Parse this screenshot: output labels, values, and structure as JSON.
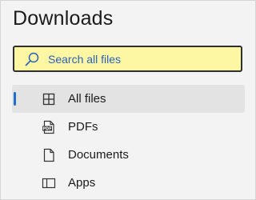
{
  "header": {
    "title": "Downloads"
  },
  "search": {
    "placeholder": "Search all files",
    "icon": "search-icon"
  },
  "nav": {
    "items": [
      {
        "label": "All files",
        "icon": "grid-icon",
        "selected": true
      },
      {
        "label": "PDFs",
        "icon": "pdf-file-icon",
        "selected": false
      },
      {
        "label": "Documents",
        "icon": "document-icon",
        "selected": false
      },
      {
        "label": "Apps",
        "icon": "app-window-icon",
        "selected": false
      }
    ]
  },
  "colors": {
    "panel_bg": "#f3f3f3",
    "search_bg": "#fdf6a3",
    "accent": "#1f6cc9",
    "placeholder": "#2b62b8",
    "selected_bg": "#e3e3e3"
  }
}
